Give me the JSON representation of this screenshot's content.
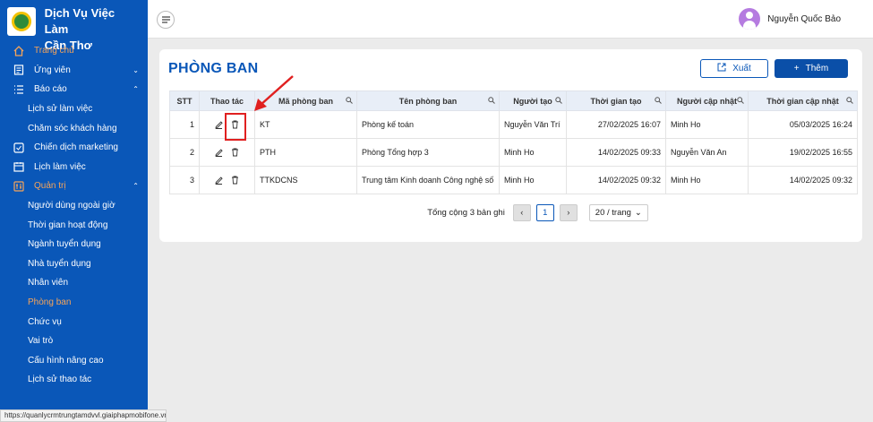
{
  "brand": {
    "title_line1": "Dịch Vụ Việc Làm",
    "title_line2": "Cần Thơ"
  },
  "sidebar": {
    "items": [
      {
        "label": "Trang chủ",
        "icon": "home-icon",
        "active_top": true
      },
      {
        "label": "Ứng viên",
        "icon": "candidate-icon",
        "chevron": "chevron-down"
      },
      {
        "label": "Báo cáo",
        "icon": "list-icon",
        "chevron": "chevron-up"
      },
      {
        "label": "Lịch sử làm việc",
        "sub": true
      },
      {
        "label": "Chăm sóc khách hàng",
        "sub": true
      },
      {
        "label": "Chiến dịch marketing",
        "icon": "marketing-icon"
      },
      {
        "label": "Lịch làm việc",
        "icon": "calendar-icon"
      },
      {
        "label": "Quản trị",
        "icon": "admin-icon",
        "chevron": "chevron-up",
        "active_top": true
      },
      {
        "label": "Người dùng ngoài giờ",
        "sub": true
      },
      {
        "label": "Thời gian hoạt động",
        "sub": true
      },
      {
        "label": "Ngành tuyển dụng",
        "sub": true
      },
      {
        "label": "Nhà tuyển dụng",
        "sub": true
      },
      {
        "label": "Nhân viên",
        "sub": true
      },
      {
        "label": "Phòng ban",
        "sub": true,
        "active": true
      },
      {
        "label": "Chức vụ",
        "sub": true
      },
      {
        "label": "Vai trò",
        "sub": true
      },
      {
        "label": "Cấu hình nâng cao",
        "sub": true
      },
      {
        "label": "Lịch sử thao tác",
        "sub": true
      }
    ]
  },
  "statusbar": {
    "url": "https://quanlycrmtrungtamdvvl.giaiphapmobifone.vn"
  },
  "header": {
    "user_name": "Nguyễn Quốc Bảo"
  },
  "page": {
    "title": "PHÒNG BAN",
    "export_label": "Xuất",
    "add_label": "Thêm"
  },
  "table": {
    "columns": [
      "STT",
      "Thao tác",
      "Mã phòng ban",
      "Tên phòng ban",
      "Người tạo",
      "Thời gian tạo",
      "Người cập nhật",
      "Thời gian cập nhật"
    ],
    "rows": [
      [
        "1",
        "",
        "KT",
        "Phòng kế toán",
        "Nguyễn Văn Trí",
        "27/02/2025 16:07",
        "Minh Ho",
        "05/03/2025 16:24"
      ],
      [
        "2",
        "",
        "PTH",
        "Phòng Tổng hợp 3",
        "Minh Ho",
        "14/02/2025 09:33",
        "Nguyễn Văn An",
        "19/02/2025 16:55"
      ],
      [
        "3",
        "",
        "TTKDCNS",
        "Trung tâm Kinh doanh Công nghệ số",
        "Minh Ho",
        "14/02/2025 09:32",
        "Minh Ho",
        "14/02/2025 09:32"
      ]
    ]
  },
  "pager": {
    "total": "Tổng cộng 3 bản ghi",
    "current": "1",
    "page_size": "20 / trang"
  },
  "colors": {
    "sidebar": "#0a57b8",
    "accent": "#0a4fa8",
    "active_text": "#f5a45a",
    "highlight": "#e02020"
  }
}
